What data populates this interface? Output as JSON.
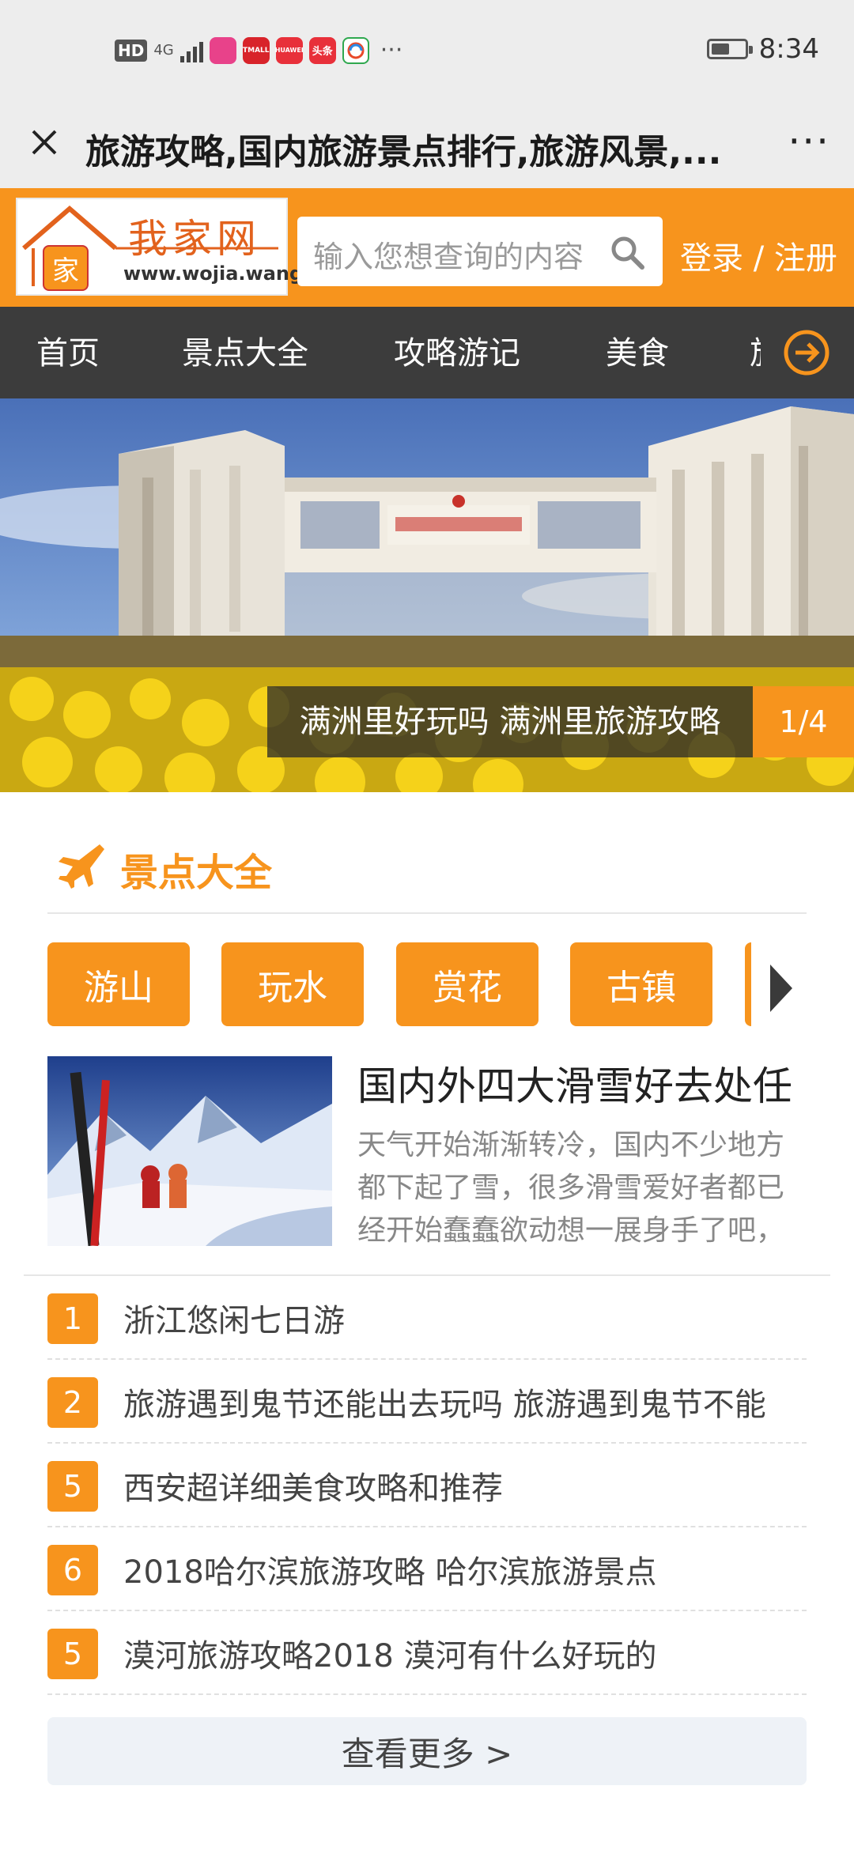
{
  "status_bar": {
    "hd": "HD",
    "network": "4G",
    "apps": [
      {
        "icon": "colorful-app-icon",
        "color": "#e8428a",
        "label": ""
      },
      {
        "icon": "tmall-icon",
        "color": "#d8232a",
        "label": "TMALL"
      },
      {
        "icon": "huawei-icon",
        "color": "#e8303a",
        "label": "HUAWEI"
      },
      {
        "icon": "toutiao-icon",
        "color": "#e8303a",
        "label": "头条"
      },
      {
        "icon": "browser-icon",
        "color": "#2fa84f",
        "label": ""
      }
    ],
    "more": "···",
    "battery_level": 0.55,
    "time": "8:34"
  },
  "title_bar": {
    "title": "旅游攻略,国内旅游景点排行,旅游风景,...",
    "more": "···"
  },
  "header": {
    "logo_name": "我家网",
    "logo_badge": "家",
    "logo_url": "www.wojia.wang",
    "search_placeholder": "输入您想查询的内容",
    "login": "登录 / 注册"
  },
  "nav": {
    "items": [
      "首页",
      "景点大全",
      "攻略游记",
      "美食",
      "旅"
    ]
  },
  "banner": {
    "caption": "满洲里好玩吗 满洲里旅游攻略",
    "counter": "1/4"
  },
  "section": {
    "title": "景点大全",
    "tags": [
      "游山",
      "玩水",
      "赏花",
      "古镇"
    ]
  },
  "feature": {
    "title": "国内外四大滑雪好去处任",
    "description": "天气开始渐渐转冷，国内不少地方都下起了雪，很多滑雪爱好者都已经开始蠢蠢欲动想一展身手了吧，"
  },
  "list": [
    {
      "num": "1",
      "text": "浙江悠闲七日游"
    },
    {
      "num": "2",
      "text": "旅游遇到鬼节还能出去玩吗 旅游遇到鬼节不能"
    },
    {
      "num": "5",
      "text": "西安超详细美食攻略和推荐"
    },
    {
      "num": "6",
      "text": "2018哈尔滨旅游攻略 哈尔滨旅游景点"
    },
    {
      "num": "5",
      "text": "漠河旅游攻略2018 漠河有什么好玩的"
    }
  ],
  "more_button": "查看更多 >",
  "colors": {
    "accent": "#f7941d",
    "nav_bg": "#3c3c3c",
    "status_bg": "#ededed"
  }
}
